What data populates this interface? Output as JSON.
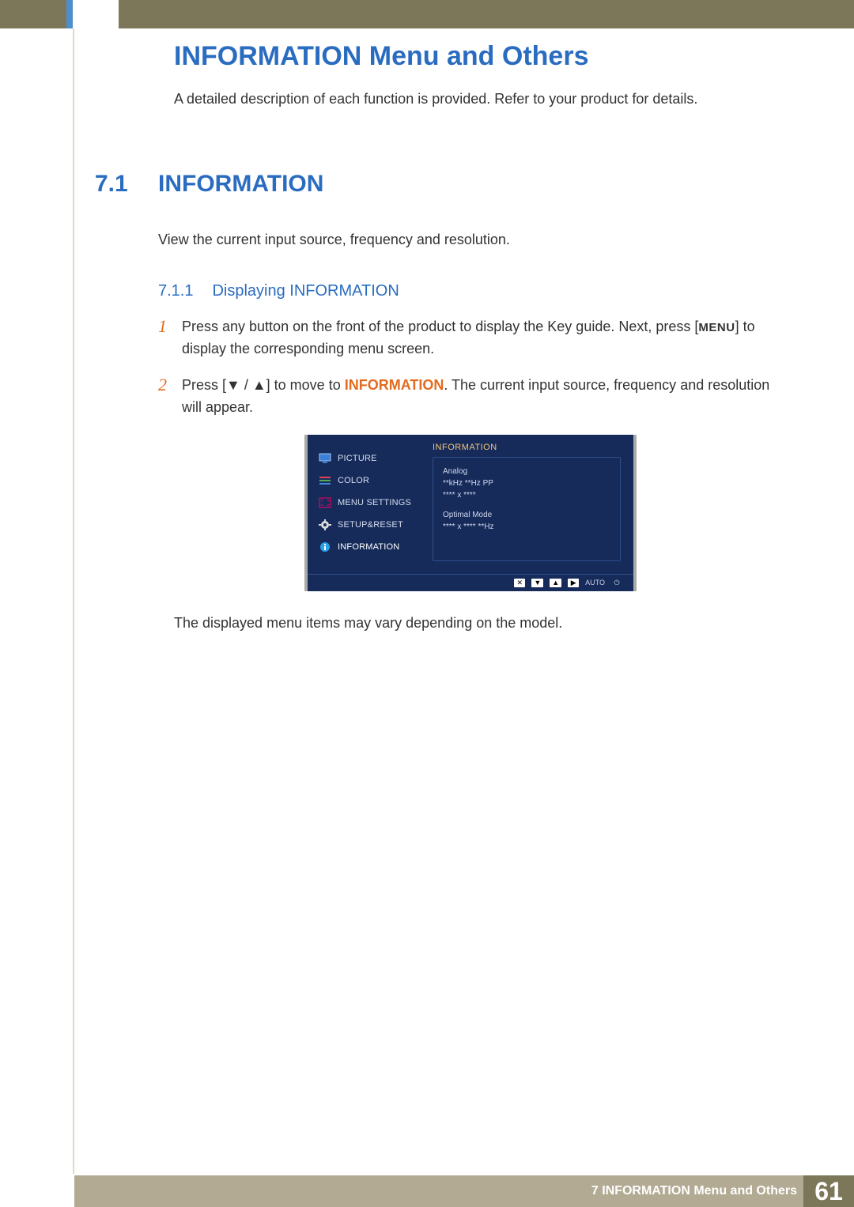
{
  "header": {
    "title": "INFORMATION Menu and Others",
    "subtitle": "A detailed description of each function is provided. Refer to your product for details."
  },
  "section": {
    "number": "7.1",
    "title": "INFORMATION",
    "body": "View the current input source, frequency and resolution."
  },
  "subsection": {
    "number": "7.1.1",
    "title": "Displaying INFORMATION"
  },
  "steps": [
    {
      "num": "1",
      "pre": "Press any button on the front of the product to display the Key guide. Next, press [",
      "menu_label": "MENU",
      "post": "] to display the corresponding menu screen."
    },
    {
      "num": "2",
      "pre": "Press [",
      "arrows": "▼ / ▲",
      "mid": "] to move to ",
      "info_word": "INFORMATION",
      "post": ". The current input source, frequency and resolution will appear."
    }
  ],
  "osd": {
    "sidebar": [
      {
        "icon": "monitor",
        "label": "PICTURE"
      },
      {
        "icon": "sliders",
        "label": "COLOR"
      },
      {
        "icon": "resize",
        "label": "MENU SETTINGS"
      },
      {
        "icon": "gear",
        "label": "SETUP&RESET"
      },
      {
        "icon": "info",
        "label": "INFORMATION",
        "selected": true
      }
    ],
    "right_title": "INFORMATION",
    "box": {
      "l1": "Analog",
      "l2": "**kHz **Hz PP",
      "l3": "**** x ****",
      "l4": "Optimal Mode",
      "l5": "**** x **** **Hz"
    },
    "bottom": {
      "k1": "✕",
      "k2": "▼",
      "k3": "▲",
      "k4": "▶",
      "auto": "AUTO",
      "power": "⏻"
    }
  },
  "note": "The displayed menu items may vary depending on the model.",
  "footer": {
    "chapter_num": "7",
    "chapter_label": "INFORMATION Menu and Others",
    "page_number": "61"
  }
}
